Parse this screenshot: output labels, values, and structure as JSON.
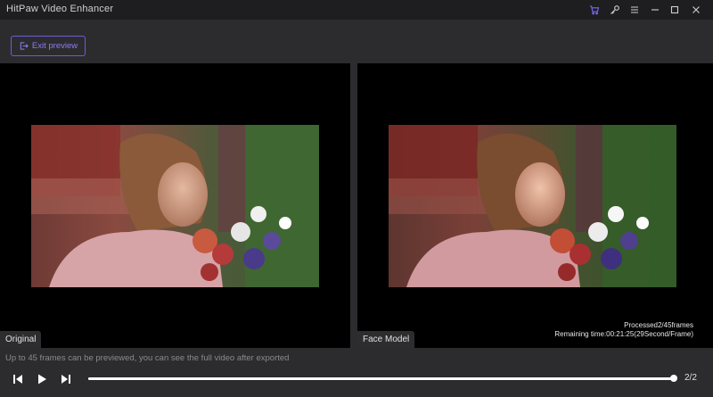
{
  "window": {
    "title": "HitPaw Video Enhancer",
    "icons": [
      "cart-icon",
      "key-icon",
      "menu-icon",
      "minimize-icon",
      "maximize-icon",
      "close-icon"
    ],
    "accent": "#6c5cd6"
  },
  "toolbar": {
    "exit_preview_label": "Exit preview"
  },
  "panes": {
    "left": {
      "label": "Original"
    },
    "right": {
      "label": "Face Model",
      "processed": "Processed2/45frames",
      "remaining": "Remaining time:00:21:25(29Second/Frame)"
    }
  },
  "info": {
    "note": "Up to 45 frames can be previewed, you can see the full video after exported"
  },
  "player": {
    "progress_fraction": 1.0,
    "page": "2/2",
    "buttons": [
      "previous-frame-icon",
      "play-icon",
      "next-frame-icon"
    ]
  }
}
